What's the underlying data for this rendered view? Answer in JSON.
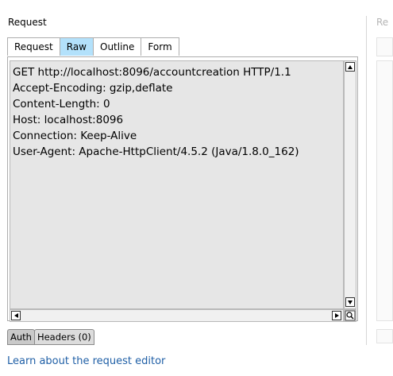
{
  "panel": {
    "title": "Request"
  },
  "tabs": [
    {
      "label": "Request",
      "active": false
    },
    {
      "label": "Raw",
      "active": true
    },
    {
      "label": "Outline",
      "active": false
    },
    {
      "label": "Form",
      "active": false
    }
  ],
  "editor": {
    "lines": [
      "GET http://localhost:8096/accountcreation HTTP/1.1",
      "Accept-Encoding: gzip,deflate",
      "Content-Length: 0",
      "Host: localhost:8096",
      "Connection: Keep-Alive",
      "User-Agent: Apache-HttpClient/4.5.2 (Java/1.8.0_162)"
    ]
  },
  "bottom_tabs": [
    {
      "label": "Auth"
    },
    {
      "label": "Headers (0)"
    }
  ],
  "link": {
    "label": "Learn about the request editor"
  },
  "right_panel": {
    "title": "Re"
  },
  "colors": {
    "active_tab": "#b3e1fb",
    "editor_bg": "#e6e6e6",
    "link": "#1f5fa6"
  },
  "icons": [
    "scroll-up-icon",
    "scroll-down-icon",
    "scroll-left-icon",
    "scroll-right-icon",
    "zoom-icon"
  ]
}
